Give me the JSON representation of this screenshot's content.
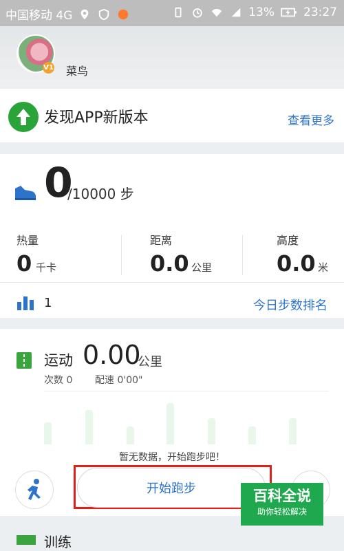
{
  "status_bar": {
    "carrier": "中国移动 4G",
    "network": "4G",
    "battery": "13%",
    "time": "23:27"
  },
  "profile": {
    "username": "菜鸟",
    "vip_badge": "V1"
  },
  "update_banner": {
    "title": "发现APP新版本",
    "link": "查看更多"
  },
  "steps": {
    "count": "0",
    "goal": "/10000 步",
    "stats": [
      {
        "label": "热量",
        "value": "0",
        "unit": "千卡"
      },
      {
        "label": "距离",
        "value": "0.0",
        "unit": "公里"
      },
      {
        "label": "高度",
        "value": "0.0",
        "unit": "米"
      }
    ],
    "rank_value": "1",
    "rank_link": "今日步数排名"
  },
  "run": {
    "title": "运动",
    "distance": "0.00",
    "unit": "公里",
    "count_text": "次数 0",
    "pace_text": "配速 0'00\"",
    "no_data": "暂无数据，开始跑步吧！",
    "start_button": "开始跑步"
  },
  "training": {
    "title": "训练"
  },
  "watermark": {
    "title": "百科全说",
    "subtitle": "助你轻松解决"
  },
  "colors": {
    "accent": "#2d73c9",
    "green": "#2aa339",
    "highlight": "#e0201b"
  }
}
